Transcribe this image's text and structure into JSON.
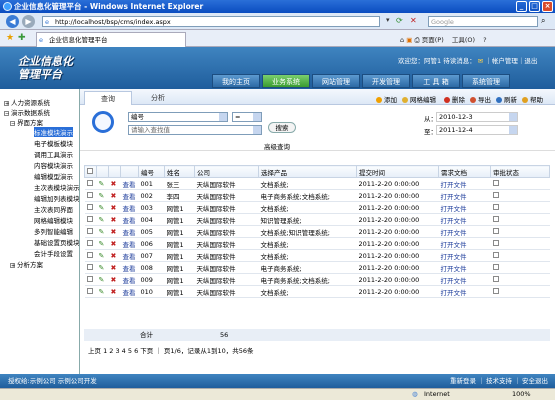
{
  "window": {
    "title": "企业信息化管理平台 - Windows Internet Explorer"
  },
  "address": {
    "url": "http://localhost/bsp/cms/index.aspx",
    "search_placeholder": "Google"
  },
  "ie_tab": {
    "label": "企业信息化管理平台"
  },
  "ie_tools": {
    "page": "页面(P)",
    "tools": "工具(O)"
  },
  "header": {
    "logo_line1": "企业信息化",
    "logo_line2": "管理平台",
    "welcome": "欢迎您：阿管1 待读消息：",
    "account": "帐户管理",
    "logout": "退出",
    "nav": [
      "我的主页",
      "业务系统",
      "网站管理",
      "开发管理",
      "工 具 箱",
      "系统管理"
    ]
  },
  "sidebar": {
    "items": [
      "人力资源系统",
      "演示数据系统",
      "界面方案",
      "标准模块演示",
      "电子模板模块",
      "调用工具演示",
      "内容模块演示",
      "编辑模型演示",
      "主次表模块演示",
      "编辑加列表模块",
      "主次表同界面",
      "网格编辑模块",
      "多列智能编辑",
      "基础设置页模块",
      "会计手段设置",
      "分析方案"
    ]
  },
  "subtabs": {
    "query": "查询",
    "analysis": "分析"
  },
  "toolbar": {
    "add": "添加",
    "batch_edit": "网格编辑",
    "delete": "删除",
    "export": "导出",
    "refresh": "刷新",
    "help": "帮助"
  },
  "search": {
    "field": "编号",
    "operator": "=",
    "placeholder": "请输入查找值",
    "button": "搜索",
    "advanced": "高级查询",
    "from_label": "从：",
    "from_date": "2010-12-3",
    "to_label": "至：",
    "to_date": "2011-12-4"
  },
  "table": {
    "headers": [
      "编号",
      "姓名",
      "公司",
      "选择产品",
      "提交时间",
      "需求文档",
      "审批状态"
    ],
    "view_label": "查看",
    "rows": [
      [
        "001",
        "张三",
        "天纵国际软件",
        "文档系统;",
        "2011-2-20 0:00:00",
        "打开文件"
      ],
      [
        "002",
        "李四",
        "天纵国际软件",
        "电子商务系统;文档系统;",
        "2011-2-20 0:00:00",
        "打开文件"
      ],
      [
        "003",
        "网管1",
        "天纵国际软件",
        "文档系统;",
        "2011-2-20 0:00:00",
        "打开文件"
      ],
      [
        "004",
        "网管1",
        "天纵国际软件",
        "知识管理系统;",
        "2011-2-20 0:00:00",
        "打开文件"
      ],
      [
        "005",
        "网管1",
        "天纵国际软件",
        "文档系统;知识管理系统;",
        "2011-2-20 0:00:00",
        "打开文件"
      ],
      [
        "006",
        "网管1",
        "天纵国际软件",
        "文档系统;",
        "2011-2-20 0:00:00",
        "打开文件"
      ],
      [
        "007",
        "网管1",
        "天纵国际软件",
        "文档系统;",
        "2011-2-20 0:00:00",
        "打开文件"
      ],
      [
        "008",
        "网管1",
        "天纵国际软件",
        "电子商务系统;",
        "2011-2-20 0:00:00",
        "打开文件"
      ],
      [
        "009",
        "网管1",
        "天纵国际软件",
        "电子商务系统;文档系统;",
        "2011-2-20 0:00:00",
        "打开文件"
      ],
      [
        "010",
        "网管1",
        "天纵国际软件",
        "文档系统;",
        "2011-2-20 0:00:00",
        "打开文件"
      ]
    ],
    "total_label": "合计",
    "total_value": "56"
  },
  "pager": {
    "text": "上页 1 2 3 4 5 6 下页 ｜ 页1/6，记录从1到10，共56条"
  },
  "footer": {
    "left": "授权给:示例公司 示例公司开发",
    "register": "重新登录",
    "support": "技术支持",
    "exit": "安全退出"
  },
  "statusbar": {
    "zone": "Internet",
    "zoom": "100%"
  }
}
